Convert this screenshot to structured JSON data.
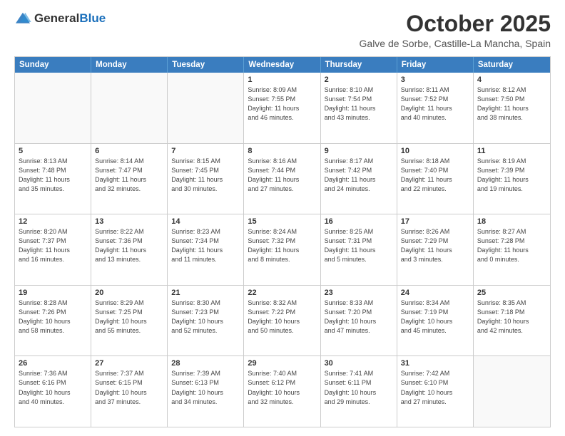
{
  "header": {
    "logo_general": "General",
    "logo_blue": "Blue",
    "month": "October 2025",
    "location": "Galve de Sorbe, Castille-La Mancha, Spain"
  },
  "days_of_week": [
    "Sunday",
    "Monday",
    "Tuesday",
    "Wednesday",
    "Thursday",
    "Friday",
    "Saturday"
  ],
  "weeks": [
    [
      {
        "day": "",
        "info": ""
      },
      {
        "day": "",
        "info": ""
      },
      {
        "day": "",
        "info": ""
      },
      {
        "day": "1",
        "info": "Sunrise: 8:09 AM\nSunset: 7:55 PM\nDaylight: 11 hours\nand 46 minutes."
      },
      {
        "day": "2",
        "info": "Sunrise: 8:10 AM\nSunset: 7:54 PM\nDaylight: 11 hours\nand 43 minutes."
      },
      {
        "day": "3",
        "info": "Sunrise: 8:11 AM\nSunset: 7:52 PM\nDaylight: 11 hours\nand 40 minutes."
      },
      {
        "day": "4",
        "info": "Sunrise: 8:12 AM\nSunset: 7:50 PM\nDaylight: 11 hours\nand 38 minutes."
      }
    ],
    [
      {
        "day": "5",
        "info": "Sunrise: 8:13 AM\nSunset: 7:48 PM\nDaylight: 11 hours\nand 35 minutes."
      },
      {
        "day": "6",
        "info": "Sunrise: 8:14 AM\nSunset: 7:47 PM\nDaylight: 11 hours\nand 32 minutes."
      },
      {
        "day": "7",
        "info": "Sunrise: 8:15 AM\nSunset: 7:45 PM\nDaylight: 11 hours\nand 30 minutes."
      },
      {
        "day": "8",
        "info": "Sunrise: 8:16 AM\nSunset: 7:44 PM\nDaylight: 11 hours\nand 27 minutes."
      },
      {
        "day": "9",
        "info": "Sunrise: 8:17 AM\nSunset: 7:42 PM\nDaylight: 11 hours\nand 24 minutes."
      },
      {
        "day": "10",
        "info": "Sunrise: 8:18 AM\nSunset: 7:40 PM\nDaylight: 11 hours\nand 22 minutes."
      },
      {
        "day": "11",
        "info": "Sunrise: 8:19 AM\nSunset: 7:39 PM\nDaylight: 11 hours\nand 19 minutes."
      }
    ],
    [
      {
        "day": "12",
        "info": "Sunrise: 8:20 AM\nSunset: 7:37 PM\nDaylight: 11 hours\nand 16 minutes."
      },
      {
        "day": "13",
        "info": "Sunrise: 8:22 AM\nSunset: 7:36 PM\nDaylight: 11 hours\nand 13 minutes."
      },
      {
        "day": "14",
        "info": "Sunrise: 8:23 AM\nSunset: 7:34 PM\nDaylight: 11 hours\nand 11 minutes."
      },
      {
        "day": "15",
        "info": "Sunrise: 8:24 AM\nSunset: 7:32 PM\nDaylight: 11 hours\nand 8 minutes."
      },
      {
        "day": "16",
        "info": "Sunrise: 8:25 AM\nSunset: 7:31 PM\nDaylight: 11 hours\nand 5 minutes."
      },
      {
        "day": "17",
        "info": "Sunrise: 8:26 AM\nSunset: 7:29 PM\nDaylight: 11 hours\nand 3 minutes."
      },
      {
        "day": "18",
        "info": "Sunrise: 8:27 AM\nSunset: 7:28 PM\nDaylight: 11 hours\nand 0 minutes."
      }
    ],
    [
      {
        "day": "19",
        "info": "Sunrise: 8:28 AM\nSunset: 7:26 PM\nDaylight: 10 hours\nand 58 minutes."
      },
      {
        "day": "20",
        "info": "Sunrise: 8:29 AM\nSunset: 7:25 PM\nDaylight: 10 hours\nand 55 minutes."
      },
      {
        "day": "21",
        "info": "Sunrise: 8:30 AM\nSunset: 7:23 PM\nDaylight: 10 hours\nand 52 minutes."
      },
      {
        "day": "22",
        "info": "Sunrise: 8:32 AM\nSunset: 7:22 PM\nDaylight: 10 hours\nand 50 minutes."
      },
      {
        "day": "23",
        "info": "Sunrise: 8:33 AM\nSunset: 7:20 PM\nDaylight: 10 hours\nand 47 minutes."
      },
      {
        "day": "24",
        "info": "Sunrise: 8:34 AM\nSunset: 7:19 PM\nDaylight: 10 hours\nand 45 minutes."
      },
      {
        "day": "25",
        "info": "Sunrise: 8:35 AM\nSunset: 7:18 PM\nDaylight: 10 hours\nand 42 minutes."
      }
    ],
    [
      {
        "day": "26",
        "info": "Sunrise: 7:36 AM\nSunset: 6:16 PM\nDaylight: 10 hours\nand 40 minutes."
      },
      {
        "day": "27",
        "info": "Sunrise: 7:37 AM\nSunset: 6:15 PM\nDaylight: 10 hours\nand 37 minutes."
      },
      {
        "day": "28",
        "info": "Sunrise: 7:39 AM\nSunset: 6:13 PM\nDaylight: 10 hours\nand 34 minutes."
      },
      {
        "day": "29",
        "info": "Sunrise: 7:40 AM\nSunset: 6:12 PM\nDaylight: 10 hours\nand 32 minutes."
      },
      {
        "day": "30",
        "info": "Sunrise: 7:41 AM\nSunset: 6:11 PM\nDaylight: 10 hours\nand 29 minutes."
      },
      {
        "day": "31",
        "info": "Sunrise: 7:42 AM\nSunset: 6:10 PM\nDaylight: 10 hours\nand 27 minutes."
      },
      {
        "day": "",
        "info": ""
      }
    ]
  ]
}
